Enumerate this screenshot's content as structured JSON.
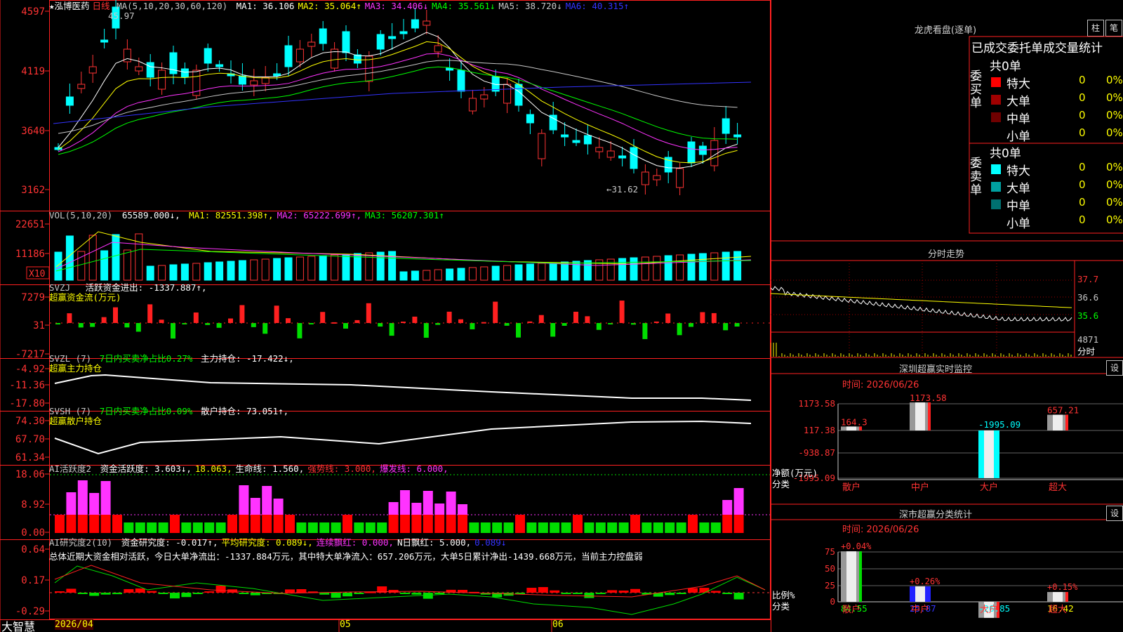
{
  "chart_data": {
    "type": "table",
    "stock": {
      "name": "★泓博医药",
      "period": "日线"
    },
    "main": {
      "ma_title": "MA(5,10,20,30,60,120)",
      "ma_values": [
        {
          "label": "MA1: 36.106",
          "color": "#ffffff"
        },
        {
          "label": "MA2: 35.064↑",
          "color": "#ffff00"
        },
        {
          "label": "MA3: 34.406↓",
          "color": "#ff33ff"
        },
        {
          "label": "MA4: 35.561↓",
          "color": "#00ff00"
        },
        {
          "label": "MA5: 38.720↓",
          "color": "#c8c8c8"
        },
        {
          "label": "MA6: 40.315↑",
          "color": "#3333ff"
        }
      ],
      "y_ticks": [
        "4597",
        "4119",
        "3640",
        "3162"
      ],
      "high_label": "45.97",
      "low_label": "←31.62"
    },
    "vol": {
      "title": "VOL(5,10,20)",
      "current": "65589.000↓,",
      "ma": [
        {
          "label": "MA1: 82551.398↑,",
          "color": "#ffff00"
        },
        {
          "label": "MA2: 65222.699↑,",
          "color": "#ff33ff"
        },
        {
          "label": "MA3: 56207.301↑",
          "color": "#00ff00"
        }
      ],
      "y_ticks": [
        "22651",
        "11186"
      ],
      "unit": "X10"
    },
    "svzj": {
      "title": "SVZJ",
      "line1": "活跃资金进出: -1337.887↑,",
      "line2": "超赢资金流(万元)",
      "y_ticks": [
        "7279",
        "31",
        "-7217"
      ]
    },
    "svzl": {
      "title": "SVZL (7)",
      "ratio": "7日内买卖净占比0.27%",
      "hold": "主力持仓: -17.422↓,",
      "line2": "超赢主力持仓",
      "y_ticks": [
        "-4.92",
        "-11.36",
        "-17.80"
      ]
    },
    "svsh": {
      "title": "SVSH (7)",
      "ratio": "7日内买卖净占比0.09%",
      "hold": "散户持仓: 73.051↑,",
      "line2": "超赢散户持仓",
      "y_ticks": [
        "74.30",
        "67.70",
        "61.34"
      ]
    },
    "ai1": {
      "title": "AI活跃度2",
      "items": [
        {
          "label": "资金活跃度: 3.603↓,",
          "color": "#ffffff"
        },
        {
          "label": "18.063,",
          "color": "#ffff00"
        },
        {
          "label": "生命线: 1.560,",
          "color": "#ffffff"
        },
        {
          "label": "强势线: 3.000,",
          "color": "#ff3333"
        },
        {
          "label": "爆发线: 6.000,",
          "color": "#ff33ff"
        }
      ],
      "y_ticks": [
        "18.06",
        "8.92",
        "0.00"
      ]
    },
    "ai2": {
      "title": "AI研究度2(10)",
      "items": [
        {
          "label": "资金研究度: -0.017↑,",
          "color": "#ffffff"
        },
        {
          "label": "平均研究度: 0.089↓,",
          "color": "#ffff00"
        },
        {
          "label": "连续飘红: 0.000,",
          "color": "#ff33ff"
        },
        {
          "label": "N日飘红: 5.000,",
          "color": "#ffffff"
        },
        {
          "label": "0.089↓",
          "color": "#3333ff"
        }
      ],
      "summary": "总体近期大资金相对活跃，今日大单净流出：-1337.884万元，其中特大单净流入：657.206万元，大单5日累计净出-1439.668万元，当前主力控盘弱",
      "y_ticks": [
        "0.64",
        "0.17",
        "-0.29"
      ]
    },
    "x_axis": [
      "2026/04",
      "05",
      "06"
    ],
    "brand": "大智慧"
  },
  "right": {
    "dragon": {
      "title": "龙虎看盘(逐单)",
      "btn_bar": "柱",
      "btn_pen": "笔"
    },
    "table_title": "已成交委托单成交量统计",
    "buy": {
      "side_label": "委买单",
      "total": "共0单",
      "rows": [
        {
          "label": "特大",
          "count": "0",
          "pct": "0%",
          "color": "#ff0000"
        },
        {
          "label": "大单",
          "count": "0",
          "pct": "0%",
          "color": "#a00000"
        },
        {
          "label": "中单",
          "count": "0",
          "pct": "0%",
          "color": "#700000"
        },
        {
          "label": "小单",
          "count": "0",
          "pct": "0%",
          "color": "#000000"
        }
      ]
    },
    "sell": {
      "side_label": "委卖单",
      "total": "共0单",
      "rows": [
        {
          "label": "特大",
          "count": "0",
          "pct": "0%",
          "color": "#00ffff"
        },
        {
          "label": "大单",
          "count": "0",
          "pct": "0%",
          "color": "#00a0a0"
        },
        {
          "label": "中单",
          "count": "0",
          "pct": "0%",
          "color": "#007070"
        },
        {
          "label": "小单",
          "count": "0",
          "pct": "0%",
          "color": "#000000"
        }
      ]
    },
    "intraday": {
      "title": "分时走势",
      "y_labels": [
        "37.7",
        "36.6",
        "35.6",
        "4871",
        "分时"
      ]
    },
    "monitor": {
      "title": "深圳超赢实时监控",
      "settings": "设",
      "time": "时间: 2026/06/26",
      "y_ticks": [
        "1173.58",
        "117.38",
        "-938.87",
        "-1995.09"
      ],
      "y_unit": "净额(万元)",
      "x_unit": "分类",
      "bars": [
        {
          "cat": "散户",
          "value": 164.3,
          "label": "164.3"
        },
        {
          "cat": "中户",
          "value": 1173.58,
          "label": "1173.58"
        },
        {
          "cat": "大户",
          "value": -1995.09,
          "label": "-1995.09"
        },
        {
          "cat": "超大",
          "value": 657.21,
          "label": "657.21"
        }
      ]
    },
    "classify": {
      "title": "深市超赢分类统计",
      "settings": "设",
      "time": "时间: 2026/06/26",
      "y_ticks": [
        "75",
        "50",
        "25",
        "0"
      ],
      "y_unit": "比例%",
      "x_unit": "分类",
      "bars": [
        {
          "cat": "散户",
          "value": 84.55,
          "top": "+0.04%",
          "label": "84.55"
        },
        {
          "cat": "中户",
          "value": 25.87,
          "top": "+0.26%",
          "label": "25.87"
        },
        {
          "cat": "大户",
          "value": -26.85,
          "top": "",
          "label": "-26.85"
        },
        {
          "cat": "超大",
          "value": 16.42,
          "top": "+0.15%",
          "label": "16.42"
        }
      ]
    }
  },
  "colors": {
    "up": "#ff3333",
    "down": "#00ffff",
    "grid": "#a00000",
    "axis": "#ff2020"
  }
}
